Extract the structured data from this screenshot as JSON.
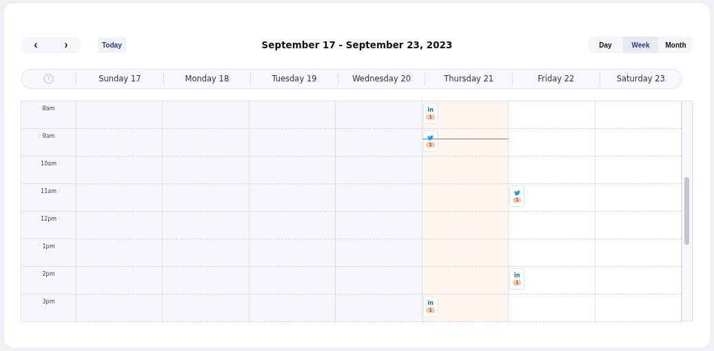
{
  "toolbar": {
    "prev": "‹",
    "next": "›",
    "today": "Today",
    "range": "September 17 - September 23, 2023",
    "views": [
      {
        "label": "Day",
        "selected": false
      },
      {
        "label": "Week",
        "selected": true
      },
      {
        "label": "Month",
        "selected": false
      }
    ]
  },
  "days": [
    {
      "label": "Sunday 17",
      "kind": "past"
    },
    {
      "label": "Monday 18",
      "kind": "past"
    },
    {
      "label": "Tuesday 19",
      "kind": "past"
    },
    {
      "label": "Wednesday 20",
      "kind": "past"
    },
    {
      "label": "Thursday 21",
      "kind": "today"
    },
    {
      "label": "Friday 22",
      "kind": "future"
    },
    {
      "label": "Saturday 23",
      "kind": "future"
    }
  ],
  "rows": [
    {
      "time": "8am",
      "cells": [
        {},
        {},
        {},
        {},
        {
          "events": [
            {
              "kind": "linkedin",
              "icon_text": "in",
              "count": "1"
            }
          ]
        },
        {},
        {}
      ]
    },
    {
      "time": "9am",
      "cells": [
        {},
        {},
        {},
        {},
        {
          "events": [
            {
              "kind": "twitter",
              "count": "1"
            }
          ],
          "now_line": true
        },
        {},
        {}
      ]
    },
    {
      "time": "10am",
      "cells": [
        {},
        {},
        {},
        {},
        {},
        {},
        {}
      ]
    },
    {
      "time": "11am",
      "cells": [
        {},
        {},
        {},
        {},
        {},
        {
          "events": [
            {
              "kind": "twitter",
              "count": "1"
            }
          ]
        },
        {}
      ]
    },
    {
      "time": "12pm",
      "cells": [
        {},
        {},
        {},
        {},
        {},
        {},
        {}
      ]
    },
    {
      "time": "1pm",
      "cells": [
        {},
        {},
        {},
        {},
        {},
        {},
        {}
      ]
    },
    {
      "time": "2pm",
      "cells": [
        {},
        {},
        {},
        {},
        {},
        {
          "events": [
            {
              "kind": "linkedin",
              "icon_text": "in",
              "count": "1"
            }
          ]
        },
        {}
      ]
    },
    {
      "time": "3pm",
      "cells": [
        {},
        {},
        {},
        {},
        {
          "events": [
            {
              "kind": "linkedin",
              "icon_text": "in",
              "count": "1"
            }
          ]
        },
        {},
        {}
      ]
    }
  ]
}
